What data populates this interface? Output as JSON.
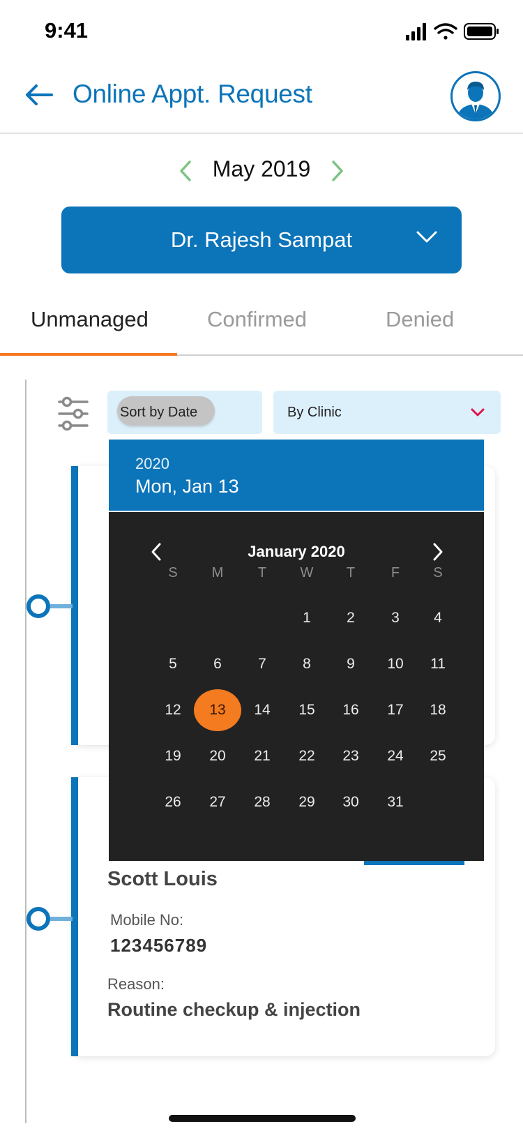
{
  "status_bar": {
    "time": "9:41"
  },
  "header": {
    "title": "Online Appt. Request"
  },
  "month_nav": {
    "label": "May 2019"
  },
  "doctor": {
    "name": "Dr. Rajesh Sampat"
  },
  "tabs": [
    {
      "label": "Unmanaged"
    },
    {
      "label": "Confirmed"
    },
    {
      "label": "Denied"
    }
  ],
  "filters": {
    "sort": "Sort by Date",
    "clinic": "By Clinic"
  },
  "calendar": {
    "year": "2020",
    "selected_date": "Mon, Jan 13",
    "month_title": "January 2020",
    "weekdays": [
      "S",
      "M",
      "T",
      "W",
      "T",
      "F",
      "S"
    ],
    "weeks": [
      [
        "",
        "",
        "",
        "1",
        "2",
        "3",
        "4"
      ],
      [
        "5",
        "6",
        "7",
        "8",
        "9",
        "10",
        "11"
      ],
      [
        "12",
        "13",
        "14",
        "15",
        "16",
        "17",
        "18"
      ],
      [
        "19",
        "20",
        "21",
        "22",
        "23",
        "24",
        "25"
      ],
      [
        "26",
        "27",
        "28",
        "29",
        "30",
        "31",
        ""
      ]
    ],
    "selected_day": "13"
  },
  "card": {
    "name": "Scott Louis",
    "mobile_label": "Mobile No:",
    "mobile_value": "123456789",
    "reason_label": "Reason:",
    "reason_value": "Routine checkup & injection"
  },
  "colors": {
    "primary": "#0c74b9",
    "accent": "#f47b20",
    "calendar_bg": "#222222",
    "filter_bg": "#dcf0fb",
    "clinic_chevron": "#e0144c",
    "month_arrows": "#7dc383"
  },
  "icons": {
    "back": "arrow-left-icon",
    "avatar": "user-avatar-icon",
    "prev_month": "chevron-left-icon",
    "next_month": "chevron-right-icon",
    "doctor_dropdown": "chevron-down-icon",
    "filter": "sliders-icon",
    "clinic_dropdown": "chevron-down-icon"
  }
}
